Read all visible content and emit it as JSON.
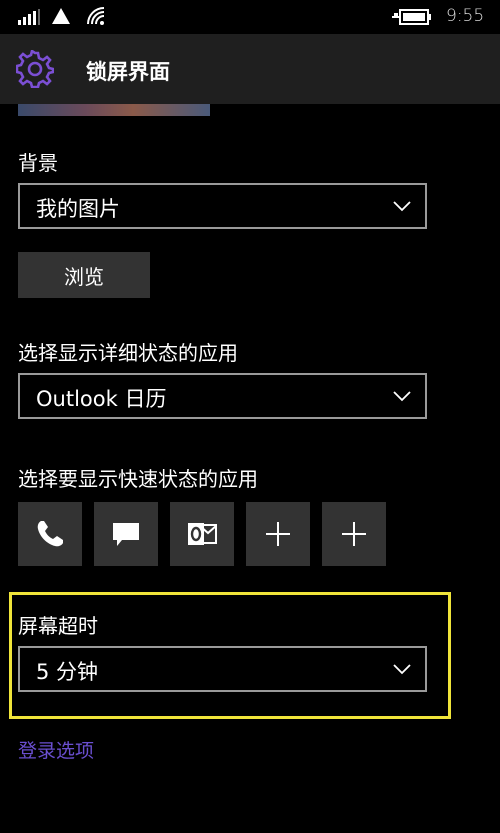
{
  "status_bar": {
    "time": "9:55",
    "icons": [
      "signal-icon",
      "no-sim-icon",
      "wifi-icon",
      "battery-charging-icon"
    ]
  },
  "header": {
    "title": "锁屏界面",
    "icon": "gear-icon",
    "accent": "#7b4fd4"
  },
  "background_section": {
    "label": "背景",
    "selected": "我的图片",
    "browse_label": "浏览"
  },
  "detailed_status": {
    "label": "选择显示详细状态的应用",
    "selected": "Outlook 日历"
  },
  "quick_status": {
    "label": "选择要显示快速状态的应用",
    "apps": [
      {
        "icon": "phone-icon"
      },
      {
        "icon": "message-icon"
      },
      {
        "icon": "outlook-icon"
      },
      {
        "icon": "add-icon"
      },
      {
        "icon": "add-icon"
      }
    ]
  },
  "screen_timeout": {
    "label": "屏幕超时",
    "selected": "5 分钟",
    "highlight_color": "#f0e53a"
  },
  "sign_in_link": "登录选项",
  "link_color": "#6a4fd0"
}
